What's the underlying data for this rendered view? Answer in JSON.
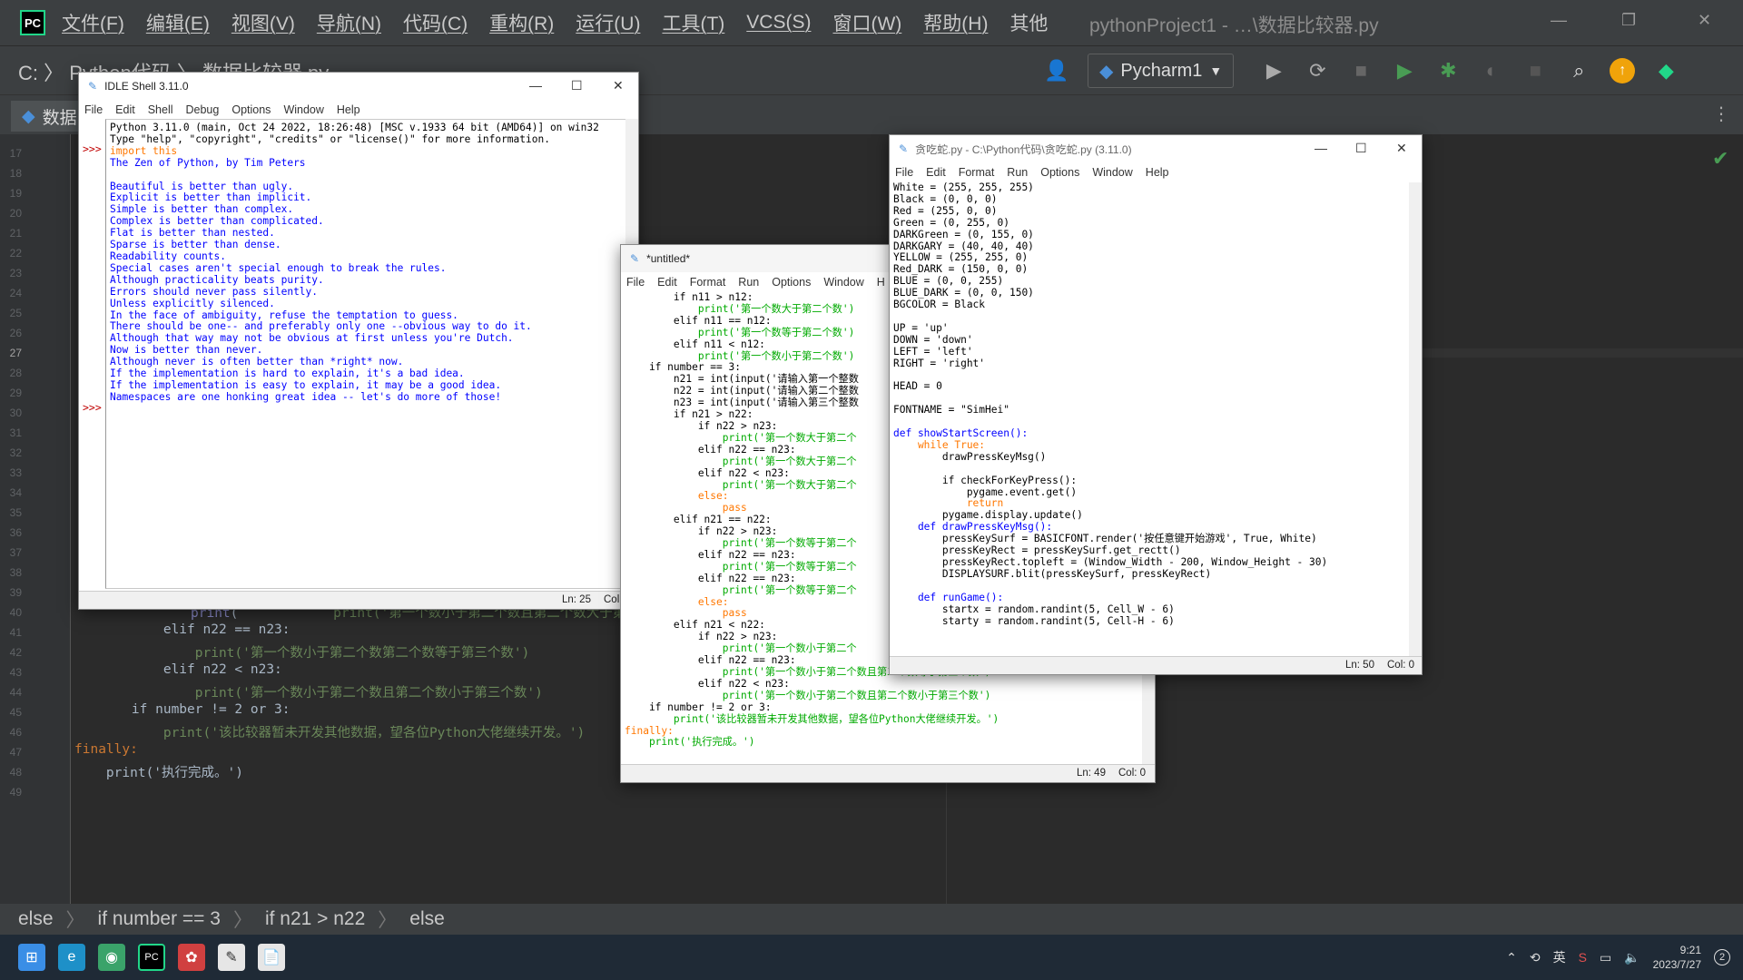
{
  "ide": {
    "logo": "PC",
    "menus": [
      "文件(F)",
      "编辑(E)",
      "视图(V)",
      "导航(N)",
      "代码(C)",
      "重构(R)",
      "运行(U)",
      "工具(T)",
      "VCS(S)",
      "窗口(W)",
      "帮助(H)",
      "其他"
    ],
    "title": "pythonProject1 - …\\数据比较器.py",
    "breadcrumb": "C: 〉 Python代码 〉 数据比较器.py",
    "run_config": "Pycharm1",
    "tab": "数据",
    "status_crumbs": [
      "else",
      "if number == 3",
      "if n21 > n22",
      "else"
    ],
    "line_numbers": [
      "17",
      "18",
      "19",
      "20",
      "21",
      "22",
      "23",
      "24",
      "25",
      "26",
      "27",
      "28",
      "29",
      "30",
      "31",
      "32",
      "33",
      "34",
      "35",
      "36",
      "37",
      "38",
      "39",
      "40",
      "41",
      "42",
      "43",
      "44",
      "45",
      "46",
      "47",
      "48",
      "49"
    ],
    "visible_code": [
      "            print('第一个数小于第二个数且第二个数大于第三个数')",
      "        elif n22 == n23:",
      "            print('第一个数小于第二个数第二个数等于第三个数')",
      "        elif n22 < n23:",
      "            print('第一个数小于第二个数且第二个数小于第三个数')",
      "    if number != 2 or 3:",
      "        print('该比较器暂未开发其他数据，望各位Python大佬继续开发。')",
      "finally:",
      "    print('执行完成。')"
    ]
  },
  "idle_shell": {
    "title": "IDLE Shell 3.11.0",
    "menus": [
      "File",
      "Edit",
      "Shell",
      "Debug",
      "Options",
      "Window",
      "Help"
    ],
    "prompt": ">>>",
    "lines": [
      "Python 3.11.0 (main, Oct 24 2022, 18:26:48) [MSC v.1933 64 bit (AMD64)] on win32",
      "Type \"help\", \"copyright\", \"credits\" or \"license()\" for more information.",
      "import this",
      "The Zen of Python, by Tim Peters",
      "",
      "Beautiful is better than ugly.",
      "Explicit is better than implicit.",
      "Simple is better than complex.",
      "Complex is better than complicated.",
      "Flat is better than nested.",
      "Sparse is better than dense.",
      "Readability counts.",
      "Special cases aren't special enough to break the rules.",
      "Although practicality beats purity.",
      "Errors should never pass silently.",
      "Unless explicitly silenced.",
      "In the face of ambiguity, refuse the temptation to guess.",
      "There should be one-- and preferably only one --obvious way to do it.",
      "Although that way may not be obvious at first unless you're Dutch.",
      "Now is better than never.",
      "Although never is often better than *right* now.",
      "If the implementation is hard to explain, it's a bad idea.",
      "If the implementation is easy to explain, it may be a good idea.",
      "Namespaces are one honking great idea -- let's do more of those!"
    ],
    "status_ln": "Ln: 25",
    "status_col": "Col:"
  },
  "untitled": {
    "title": "*untitled*",
    "menus": [
      "File",
      "Edit",
      "Format",
      "Run",
      "Options",
      "Window",
      "H"
    ],
    "status_ln": "Ln: 49",
    "status_col": "Col: 0",
    "lines": [
      "        if n11 > n12:",
      "            print('第一个数大于第二个数')",
      "        elif n11 == n12:",
      "            print('第一个数等于第二个数')",
      "        elif n11 < n12:",
      "            print('第一个数小于第二个数')",
      "    if number == 3:",
      "        n21 = int(input('请输入第一个整数",
      "        n22 = int(input('请输入第二个整数",
      "        n23 = int(input('请输入第三个整数",
      "        if n21 > n22:",
      "            if n22 > n23:",
      "                print('第一个数大于第二个",
      "            elif n22 == n23:",
      "                print('第一个数大于第二个",
      "            elif n22 < n23:",
      "                print('第一个数大于第二个",
      "            else:",
      "                pass",
      "        elif n21 == n22:",
      "            if n22 > n23:",
      "                print('第一个数等于第二个",
      "            elif n22 == n23:",
      "                print('第一个数等于第二个",
      "            elif n22 == n23:",
      "                print('第一个数等于第二个",
      "            else:",
      "                pass",
      "        elif n21 < n22:",
      "            if n22 > n23:",
      "                print('第一个数小于第二个",
      "            elif n22 == n23:",
      "                print('第一个数小于第二个数且第二个数等于第三个数')",
      "            elif n22 < n23:",
      "                print('第一个数小于第二个数且第二个数小于第三个数')",
      "    if number != 2 or 3:",
      "        print('该比较器暂未开发其他数据，望各位Python大佬继续开发。')",
      "finally:",
      "    print('执行完成。')"
    ]
  },
  "snake": {
    "title": "贪吃蛇.py - C:\\Python代码\\贪吃蛇.py (3.11.0)",
    "menus": [
      "File",
      "Edit",
      "Format",
      "Run",
      "Options",
      "Window",
      "Help"
    ],
    "status_ln": "Ln: 50",
    "status_col": "Col: 0",
    "lines": [
      "White = (255, 255, 255)",
      "Black = (0, 0, 0)",
      "Red = (255, 0, 0)",
      "Green = (0, 255, 0)",
      "DARKGreen = (0, 155, 0)",
      "DARKGARY = (40, 40, 40)",
      "YELLOW = (255, 255, 0)",
      "Red_DARK = (150, 0, 0)",
      "BLUE = (0, 0, 255)",
      "BLUE_DARK = (0, 0, 150)",
      "BGCOLOR = Black",
      "",
      "UP = 'up'",
      "DOWN = 'down'",
      "LEFT = 'left'",
      "RIGHT = 'right'",
      "",
      "HEAD = 0",
      "",
      "FONTNAME = \"SimHei\"",
      "",
      "def showStartScreen():",
      "    while True:",
      "        drawPressKeyMsg()",
      "",
      "        if checkForKeyPress():",
      "            pygame.event.get()",
      "            return",
      "        pygame.display.update()",
      "    def drawPressKeyMsg():",
      "        pressKeySurf = BASICFONT.render('按任意键开始游戏', True, White)",
      "        pressKeyRect = pressKeySurf.get_rectt()",
      "        pressKeyRect.topleft = (Window_Width - 200, Window_Height - 30)",
      "        DISPLAYSURF.blit(pressKeySurf, pressKeyRect)",
      "",
      "    def runGame():",
      "        startx = random.randint(5, Cell_W - 6)",
      "        starty = random.randint(5, Cell-H - 6)"
    ]
  },
  "taskbar": {
    "lang": "英",
    "time": "9:21",
    "date": "2023/7/27",
    "badge": "2"
  }
}
